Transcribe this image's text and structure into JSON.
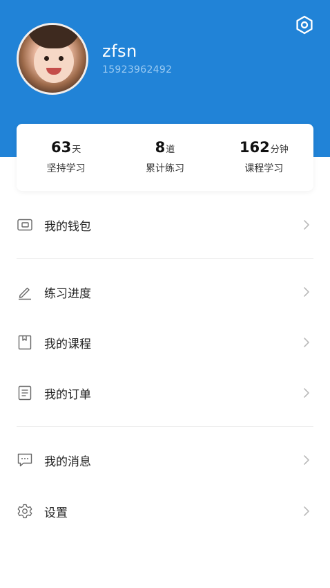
{
  "profile": {
    "username": "zfsn",
    "phone": "15923962492"
  },
  "stats": [
    {
      "value": "63",
      "unit": "天",
      "label": "坚持学习"
    },
    {
      "value": "8",
      "unit": "道",
      "label": "累计练习"
    },
    {
      "value": "162",
      "unit": "分钟",
      "label": "课程学习"
    }
  ],
  "menu": {
    "wallet": "我的钱包",
    "progress": "练习进度",
    "courses": "我的课程",
    "orders": "我的订单",
    "messages": "我的消息",
    "settings": "设置"
  },
  "icons": {
    "header_settings": "hexagon-settings-icon",
    "wallet": "wallet-icon",
    "progress": "pencil-icon",
    "courses": "bookmark-book-icon",
    "orders": "document-icon",
    "messages": "chat-bubble-icon",
    "settings": "gear-icon",
    "arrow": "chevron-right-icon"
  },
  "colors": {
    "header_bg": "#2183d7",
    "phone_text": "#9ccbf2",
    "icon_gray": "#666666",
    "chevron": "#bbbbbb"
  }
}
